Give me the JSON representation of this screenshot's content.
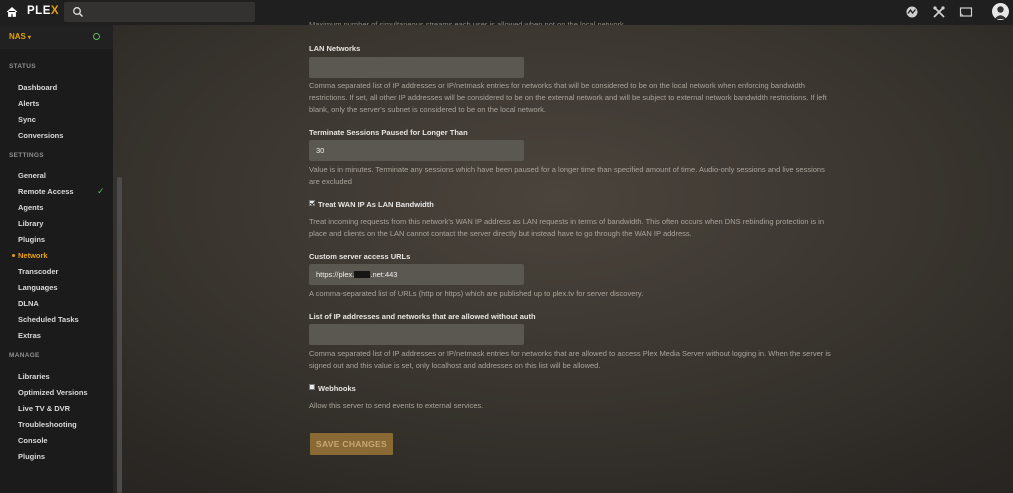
{
  "app": {
    "logo_pl": "PLE",
    "logo_x": "X"
  },
  "search": {
    "placeholder": ""
  },
  "sidebar": {
    "server_name": "NAS",
    "server_caret": "▾",
    "sections": [
      {
        "title": "STATUS",
        "items": [
          "Dashboard",
          "Alerts",
          "Sync",
          "Conversions"
        ]
      },
      {
        "title": "SETTINGS",
        "items": [
          "General",
          "Remote Access",
          "Agents",
          "Library",
          "Plugins",
          "Network",
          "Transcoder",
          "Languages",
          "DLNA",
          "Scheduled Tasks",
          "Extras"
        ]
      },
      {
        "title": "MANAGE",
        "items": [
          "Libraries",
          "Optimized Versions",
          "Live TV & DVR",
          "Troubleshooting",
          "Console",
          "Plugins"
        ]
      }
    ],
    "active_item": "Network",
    "remote_access_status": "✓"
  },
  "content": {
    "clipped_text": "Maximum number of simultaneous streams each user is allowed when not on the local network.",
    "lan_networks": {
      "label": "LAN Networks",
      "value": "",
      "help": "Comma separated list of IP addresses or IP/netmask entries for networks that will be considered to be on the local network when enforcing bandwidth restrictions. If set, all other IP addresses will be considered to be on the external network and will be subject to external network bandwidth restrictions. If left blank, only the server's subnet is considered to be on the local network."
    },
    "terminate_sessions": {
      "label": "Terminate Sessions Paused for Longer Than",
      "value": "30",
      "help": "Value is in minutes. Terminate any sessions which have been paused for a longer time than specified amount of time. Audio-only sessions and live sessions are excluded"
    },
    "treat_wan": {
      "label": "Treat WAN IP As LAN Bandwidth",
      "checked": true,
      "help": "Treat incoming requests from this network's WAN IP address as LAN requests in terms of bandwidth. This often occurs when DNS rebinding protection is in place and clients on the LAN cannot contact the server directly but instead have to go through the WAN IP address."
    },
    "custom_urls": {
      "label": "Custom server access URLs",
      "value_prefix": "https://plex.",
      "value_suffix": ".net:443",
      "help": "A comma-separated list of URLs (http or https) which are published up to plex.tv for server discovery."
    },
    "allowed_networks": {
      "label": "List of IP addresses and networks that are allowed without auth",
      "value": "",
      "help": "Comma separated list of IP addresses or IP/netmask entries for networks that are allowed to access Plex Media Server without logging in. When the server is signed out and this value is set, only localhost and addresses on this list will be allowed."
    },
    "webhooks": {
      "label": "Webhooks",
      "checked": false,
      "help": "Allow this server to send events to external services."
    },
    "save_label": "SAVE CHANGES"
  },
  "colors": {
    "accent": "#e5a00d",
    "ok": "#5cb85c",
    "sidebar_bg": "#1b1b1b",
    "topbar_bg": "#1f1f1f"
  },
  "icons": {
    "home": "home-icon",
    "search": "search-icon",
    "activity": "activity-icon",
    "settings": "wrench-icon",
    "cast": "cast-icon"
  }
}
